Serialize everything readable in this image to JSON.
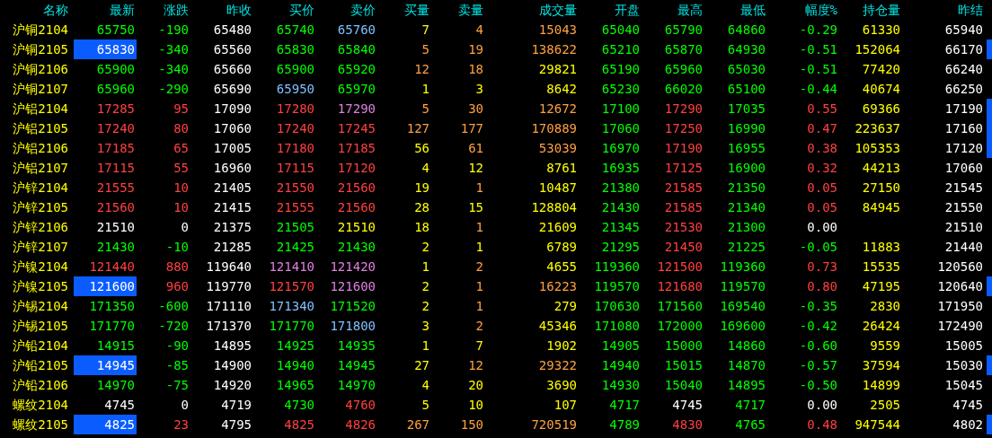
{
  "columns": [
    "名称",
    "最新",
    "涨跌",
    "昨收",
    "买价",
    "卖价",
    "买量",
    "卖量",
    "成交量",
    "开盘",
    "最高",
    "最低",
    "幅度%",
    "持仓量",
    "昨结"
  ],
  "rows": [
    {
      "marked": false,
      "cells": [
        {
          "text": "沪铜2104",
          "color": "#ffff00"
        },
        {
          "text": "65750",
          "color": "#00ff00",
          "flash": false
        },
        {
          "text": "-190",
          "color": "#00ff00"
        },
        {
          "text": "65480",
          "color": "#ffffff"
        },
        {
          "text": "65740",
          "color": "#00ff00"
        },
        {
          "text": "65760",
          "color": "#80c0ff"
        },
        {
          "text": "7",
          "color": "#ffff00"
        },
        {
          "text": "4",
          "color": "#ffa040"
        },
        {
          "text": "15043",
          "color": "#ffa040"
        },
        {
          "text": "65040",
          "color": "#00ff00"
        },
        {
          "text": "65790",
          "color": "#00ff00"
        },
        {
          "text": "64860",
          "color": "#00ff00"
        },
        {
          "text": "-0.29",
          "color": "#00ff00"
        },
        {
          "text": "61330",
          "color": "#ffff00"
        },
        {
          "text": "65940",
          "color": "#ffffff"
        }
      ]
    },
    {
      "marked": true,
      "cells": [
        {
          "text": "沪铜2105",
          "color": "#ffff00"
        },
        {
          "text": "65830",
          "color": "#ffffff",
          "flash": true
        },
        {
          "text": "-340",
          "color": "#00ff00"
        },
        {
          "text": "65560",
          "color": "#ffffff"
        },
        {
          "text": "65830",
          "color": "#00ff00"
        },
        {
          "text": "65840",
          "color": "#00ff00"
        },
        {
          "text": "5",
          "color": "#ffa040"
        },
        {
          "text": "19",
          "color": "#ffa040"
        },
        {
          "text": "138622",
          "color": "#ffa040"
        },
        {
          "text": "65210",
          "color": "#00ff00"
        },
        {
          "text": "65870",
          "color": "#00ff00"
        },
        {
          "text": "64930",
          "color": "#00ff00"
        },
        {
          "text": "-0.51",
          "color": "#00ff00"
        },
        {
          "text": "152064",
          "color": "#ffff00"
        },
        {
          "text": "66170",
          "color": "#ffffff"
        }
      ]
    },
    {
      "marked": false,
      "cells": [
        {
          "text": "沪铜2106",
          "color": "#ffff00"
        },
        {
          "text": "65900",
          "color": "#00ff00",
          "flash": false
        },
        {
          "text": "-340",
          "color": "#00ff00"
        },
        {
          "text": "65660",
          "color": "#ffffff"
        },
        {
          "text": "65900",
          "color": "#00ff00"
        },
        {
          "text": "65920",
          "color": "#00ff00"
        },
        {
          "text": "12",
          "color": "#ffa040"
        },
        {
          "text": "18",
          "color": "#ffa040"
        },
        {
          "text": "29821",
          "color": "#ffff00"
        },
        {
          "text": "65190",
          "color": "#00ff00"
        },
        {
          "text": "65960",
          "color": "#00ff00"
        },
        {
          "text": "65030",
          "color": "#00ff00"
        },
        {
          "text": "-0.51",
          "color": "#00ff00"
        },
        {
          "text": "77420",
          "color": "#ffff00"
        },
        {
          "text": "66240",
          "color": "#ffffff"
        }
      ]
    },
    {
      "marked": false,
      "cells": [
        {
          "text": "沪铜2107",
          "color": "#ffff00"
        },
        {
          "text": "65960",
          "color": "#00ff00",
          "flash": false
        },
        {
          "text": "-290",
          "color": "#00ff00"
        },
        {
          "text": "65690",
          "color": "#ffffff"
        },
        {
          "text": "65950",
          "color": "#80c0ff"
        },
        {
          "text": "65970",
          "color": "#00ff00"
        },
        {
          "text": "1",
          "color": "#ffff00"
        },
        {
          "text": "3",
          "color": "#ffff00"
        },
        {
          "text": "8642",
          "color": "#ffff00"
        },
        {
          "text": "65230",
          "color": "#00ff00"
        },
        {
          "text": "66020",
          "color": "#00ff00"
        },
        {
          "text": "65100",
          "color": "#00ff00"
        },
        {
          "text": "-0.44",
          "color": "#00ff00"
        },
        {
          "text": "40674",
          "color": "#ffff00"
        },
        {
          "text": "66250",
          "color": "#ffffff"
        }
      ]
    },
    {
      "marked": true,
      "cells": [
        {
          "text": "沪铝2104",
          "color": "#ffff00"
        },
        {
          "text": "17285",
          "color": "#ff4040",
          "flash": false
        },
        {
          "text": "95",
          "color": "#ff4040"
        },
        {
          "text": "17090",
          "color": "#ffffff"
        },
        {
          "text": "17280",
          "color": "#ff4040"
        },
        {
          "text": "17290",
          "color": "#e080e0"
        },
        {
          "text": "5",
          "color": "#ffa040"
        },
        {
          "text": "30",
          "color": "#ffa040"
        },
        {
          "text": "12672",
          "color": "#ffa040"
        },
        {
          "text": "17100",
          "color": "#00ff00"
        },
        {
          "text": "17290",
          "color": "#ff4040"
        },
        {
          "text": "17035",
          "color": "#00ff00"
        },
        {
          "text": "0.55",
          "color": "#ff4040"
        },
        {
          "text": "69366",
          "color": "#ffff00"
        },
        {
          "text": "17190",
          "color": "#ffffff"
        }
      ]
    },
    {
      "marked": true,
      "cells": [
        {
          "text": "沪铝2105",
          "color": "#ffff00"
        },
        {
          "text": "17240",
          "color": "#ff4040",
          "flash": false
        },
        {
          "text": "80",
          "color": "#ff4040"
        },
        {
          "text": "17060",
          "color": "#ffffff"
        },
        {
          "text": "17240",
          "color": "#ff4040"
        },
        {
          "text": "17245",
          "color": "#ff4040"
        },
        {
          "text": "127",
          "color": "#ffa040"
        },
        {
          "text": "177",
          "color": "#ffa040"
        },
        {
          "text": "170889",
          "color": "#ffa040"
        },
        {
          "text": "17060",
          "color": "#00ff00"
        },
        {
          "text": "17250",
          "color": "#ff4040"
        },
        {
          "text": "16990",
          "color": "#00ff00"
        },
        {
          "text": "0.47",
          "color": "#ff4040"
        },
        {
          "text": "223637",
          "color": "#ffff00"
        },
        {
          "text": "17160",
          "color": "#ffffff"
        }
      ]
    },
    {
      "marked": true,
      "cells": [
        {
          "text": "沪铝2106",
          "color": "#ffff00"
        },
        {
          "text": "17185",
          "color": "#ff4040",
          "flash": false
        },
        {
          "text": "65",
          "color": "#ff4040"
        },
        {
          "text": "17005",
          "color": "#ffffff"
        },
        {
          "text": "17180",
          "color": "#ff4040"
        },
        {
          "text": "17185",
          "color": "#ff4040"
        },
        {
          "text": "56",
          "color": "#ffff00"
        },
        {
          "text": "61",
          "color": "#ffa040"
        },
        {
          "text": "53039",
          "color": "#ffa040"
        },
        {
          "text": "16970",
          "color": "#00ff00"
        },
        {
          "text": "17190",
          "color": "#ff4040"
        },
        {
          "text": "16955",
          "color": "#00ff00"
        },
        {
          "text": "0.38",
          "color": "#ff4040"
        },
        {
          "text": "105353",
          "color": "#ffff00"
        },
        {
          "text": "17120",
          "color": "#ffffff"
        }
      ]
    },
    {
      "marked": false,
      "cells": [
        {
          "text": "沪铝2107",
          "color": "#ffff00"
        },
        {
          "text": "17115",
          "color": "#ff4040",
          "flash": false
        },
        {
          "text": "55",
          "color": "#ff4040"
        },
        {
          "text": "16960",
          "color": "#ffffff"
        },
        {
          "text": "17115",
          "color": "#ff4040"
        },
        {
          "text": "17120",
          "color": "#ff4040"
        },
        {
          "text": "4",
          "color": "#ffff00"
        },
        {
          "text": "12",
          "color": "#ffff00"
        },
        {
          "text": "8761",
          "color": "#ffff00"
        },
        {
          "text": "16935",
          "color": "#00ff00"
        },
        {
          "text": "17125",
          "color": "#ff4040"
        },
        {
          "text": "16900",
          "color": "#00ff00"
        },
        {
          "text": "0.32",
          "color": "#ff4040"
        },
        {
          "text": "44213",
          "color": "#ffff00"
        },
        {
          "text": "17060",
          "color": "#ffffff"
        }
      ]
    },
    {
      "marked": false,
      "cells": [
        {
          "text": "沪锌2104",
          "color": "#ffff00"
        },
        {
          "text": "21555",
          "color": "#ff4040",
          "flash": false
        },
        {
          "text": "10",
          "color": "#ff4040"
        },
        {
          "text": "21405",
          "color": "#ffffff"
        },
        {
          "text": "21550",
          "color": "#ff4040"
        },
        {
          "text": "21560",
          "color": "#ff4040"
        },
        {
          "text": "19",
          "color": "#ffff00"
        },
        {
          "text": "1",
          "color": "#ffa040"
        },
        {
          "text": "10487",
          "color": "#ffff00"
        },
        {
          "text": "21380",
          "color": "#00ff00"
        },
        {
          "text": "21585",
          "color": "#ff4040"
        },
        {
          "text": "21350",
          "color": "#00ff00"
        },
        {
          "text": "0.05",
          "color": "#ff4040"
        },
        {
          "text": "27150",
          "color": "#ffff00"
        },
        {
          "text": "21545",
          "color": "#ffffff"
        }
      ]
    },
    {
      "marked": false,
      "cells": [
        {
          "text": "沪锌2105",
          "color": "#ffff00"
        },
        {
          "text": "21560",
          "color": "#ff4040",
          "flash": false
        },
        {
          "text": "10",
          "color": "#ff4040"
        },
        {
          "text": "21415",
          "color": "#ffffff"
        },
        {
          "text": "21555",
          "color": "#ff4040"
        },
        {
          "text": "21560",
          "color": "#ff4040"
        },
        {
          "text": "28",
          "color": "#ffff00"
        },
        {
          "text": "15",
          "color": "#ffff00"
        },
        {
          "text": "128804",
          "color": "#ffff00"
        },
        {
          "text": "21430",
          "color": "#00ff00"
        },
        {
          "text": "21585",
          "color": "#ff4040"
        },
        {
          "text": "21340",
          "color": "#00ff00"
        },
        {
          "text": "0.05",
          "color": "#ff4040"
        },
        {
          "text": "84945",
          "color": "#ffff00"
        },
        {
          "text": "21550",
          "color": "#ffffff"
        }
      ]
    },
    {
      "marked": false,
      "cells": [
        {
          "text": "沪锌2106",
          "color": "#ffff00"
        },
        {
          "text": "21510",
          "color": "#ffffff",
          "flash": false
        },
        {
          "text": "0",
          "color": "#ffffff"
        },
        {
          "text": "21375",
          "color": "#ffffff"
        },
        {
          "text": "21505",
          "color": "#00ff00"
        },
        {
          "text": "21510",
          "color": "#ffff00"
        },
        {
          "text": "18",
          "color": "#ffff00"
        },
        {
          "text": "1",
          "color": "#ffa040"
        },
        {
          "text": "21609",
          "color": "#ffff00"
        },
        {
          "text": "21345",
          "color": "#00ff00"
        },
        {
          "text": "21530",
          "color": "#ff4040"
        },
        {
          "text": "21300",
          "color": "#00ff00"
        },
        {
          "text": "0.00",
          "color": "#ffffff"
        },
        null,
        {
          "text": "21510",
          "color": "#ffffff"
        }
      ]
    },
    {
      "marked": false,
      "cells": [
        {
          "text": "沪锌2107",
          "color": "#ffff00"
        },
        {
          "text": "21430",
          "color": "#00ff00",
          "flash": false
        },
        {
          "text": "-10",
          "color": "#00ff00"
        },
        {
          "text": "21285",
          "color": "#ffffff"
        },
        {
          "text": "21425",
          "color": "#00ff00"
        },
        {
          "text": "21430",
          "color": "#00ff00"
        },
        {
          "text": "2",
          "color": "#ffff00"
        },
        {
          "text": "1",
          "color": "#ffff00"
        },
        {
          "text": "6789",
          "color": "#ffff00"
        },
        {
          "text": "21295",
          "color": "#00ff00"
        },
        {
          "text": "21450",
          "color": "#ff4040"
        },
        {
          "text": "21225",
          "color": "#00ff00"
        },
        {
          "text": "-0.05",
          "color": "#00ff00"
        },
        {
          "text": "11883",
          "color": "#ffff00"
        },
        {
          "text": "21440",
          "color": "#ffffff"
        }
      ]
    },
    {
      "marked": false,
      "cells": [
        {
          "text": "沪镍2104",
          "color": "#ffff00"
        },
        {
          "text": "121440",
          "color": "#ff4040",
          "flash": false
        },
        {
          "text": "880",
          "color": "#ff4040"
        },
        {
          "text": "119640",
          "color": "#ffffff"
        },
        {
          "text": "121410",
          "color": "#e080e0"
        },
        {
          "text": "121420",
          "color": "#e080e0"
        },
        {
          "text": "1",
          "color": "#ffff00"
        },
        {
          "text": "2",
          "color": "#ffa040"
        },
        {
          "text": "4655",
          "color": "#ffff00"
        },
        {
          "text": "119360",
          "color": "#00ff00"
        },
        {
          "text": "121500",
          "color": "#ff4040"
        },
        {
          "text": "119360",
          "color": "#00ff00"
        },
        {
          "text": "0.73",
          "color": "#ff4040"
        },
        {
          "text": "15535",
          "color": "#ffff00"
        },
        {
          "text": "120560",
          "color": "#ffffff"
        }
      ]
    },
    {
      "marked": true,
      "cells": [
        {
          "text": "沪镍2105",
          "color": "#ffff00"
        },
        {
          "text": "121600",
          "color": "#ffffff",
          "flash": true
        },
        {
          "text": "960",
          "color": "#ff4040"
        },
        {
          "text": "119770",
          "color": "#ffffff"
        },
        {
          "text": "121570",
          "color": "#ff4040"
        },
        {
          "text": "121600",
          "color": "#e080e0"
        },
        {
          "text": "2",
          "color": "#ffff00"
        },
        {
          "text": "1",
          "color": "#ffa040"
        },
        {
          "text": "16223",
          "color": "#ffa040"
        },
        {
          "text": "119570",
          "color": "#00ff00"
        },
        {
          "text": "121680",
          "color": "#ff4040"
        },
        {
          "text": "119570",
          "color": "#00ff00"
        },
        {
          "text": "0.80",
          "color": "#ff4040"
        },
        {
          "text": "47195",
          "color": "#ffff00"
        },
        {
          "text": "120640",
          "color": "#ffffff"
        }
      ]
    },
    {
      "marked": false,
      "cells": [
        {
          "text": "沪锡2104",
          "color": "#ffff00"
        },
        {
          "text": "171350",
          "color": "#00ff00",
          "flash": false
        },
        {
          "text": "-600",
          "color": "#00ff00"
        },
        {
          "text": "171110",
          "color": "#ffffff"
        },
        {
          "text": "171340",
          "color": "#80c0ff"
        },
        {
          "text": "171520",
          "color": "#00ff00"
        },
        {
          "text": "2",
          "color": "#ffff00"
        },
        {
          "text": "1",
          "color": "#ffa040"
        },
        {
          "text": "279",
          "color": "#ffff00"
        },
        {
          "text": "170630",
          "color": "#00ff00"
        },
        {
          "text": "171560",
          "color": "#00ff00"
        },
        {
          "text": "169540",
          "color": "#00ff00"
        },
        {
          "text": "-0.35",
          "color": "#00ff00"
        },
        {
          "text": "2830",
          "color": "#ffff00"
        },
        {
          "text": "171950",
          "color": "#ffffff"
        }
      ]
    },
    {
      "marked": false,
      "cells": [
        {
          "text": "沪锡2105",
          "color": "#ffff00"
        },
        {
          "text": "171770",
          "color": "#00ff00",
          "flash": false
        },
        {
          "text": "-720",
          "color": "#00ff00"
        },
        {
          "text": "171370",
          "color": "#ffffff"
        },
        {
          "text": "171770",
          "color": "#00ff00"
        },
        {
          "text": "171800",
          "color": "#80c0ff"
        },
        {
          "text": "3",
          "color": "#ffff00"
        },
        {
          "text": "2",
          "color": "#ffa040"
        },
        {
          "text": "45346",
          "color": "#ffff00"
        },
        {
          "text": "171080",
          "color": "#00ff00"
        },
        {
          "text": "172000",
          "color": "#00ff00"
        },
        {
          "text": "169600",
          "color": "#00ff00"
        },
        {
          "text": "-0.42",
          "color": "#00ff00"
        },
        {
          "text": "26424",
          "color": "#ffff00"
        },
        {
          "text": "172490",
          "color": "#ffffff"
        }
      ]
    },
    {
      "marked": false,
      "cells": [
        {
          "text": "沪铅2104",
          "color": "#ffff00"
        },
        {
          "text": "14915",
          "color": "#00ff00",
          "flash": false
        },
        {
          "text": "-90",
          "color": "#00ff00"
        },
        {
          "text": "14895",
          "color": "#ffffff"
        },
        {
          "text": "14925",
          "color": "#00ff00"
        },
        {
          "text": "14935",
          "color": "#00ff00"
        },
        {
          "text": "1",
          "color": "#ffff00"
        },
        {
          "text": "7",
          "color": "#ffff00"
        },
        {
          "text": "1902",
          "color": "#ffff00"
        },
        {
          "text": "14905",
          "color": "#00ff00"
        },
        {
          "text": "15000",
          "color": "#00ff00"
        },
        {
          "text": "14860",
          "color": "#00ff00"
        },
        {
          "text": "-0.60",
          "color": "#00ff00"
        },
        {
          "text": "9559",
          "color": "#ffff00"
        },
        {
          "text": "15005",
          "color": "#ffffff"
        }
      ]
    },
    {
      "marked": true,
      "cells": [
        {
          "text": "沪铅2105",
          "color": "#ffff00"
        },
        {
          "text": "14945",
          "color": "#ffffff",
          "flash": true
        },
        {
          "text": "-85",
          "color": "#00ff00"
        },
        {
          "text": "14900",
          "color": "#ffffff"
        },
        {
          "text": "14940",
          "color": "#00ff00"
        },
        {
          "text": "14945",
          "color": "#00ff00"
        },
        {
          "text": "27",
          "color": "#ffff00"
        },
        {
          "text": "12",
          "color": "#ffa040"
        },
        {
          "text": "29322",
          "color": "#ffa040"
        },
        {
          "text": "14940",
          "color": "#00ff00"
        },
        {
          "text": "15015",
          "color": "#00ff00"
        },
        {
          "text": "14870",
          "color": "#00ff00"
        },
        {
          "text": "-0.57",
          "color": "#00ff00"
        },
        {
          "text": "37594",
          "color": "#ffff00"
        },
        {
          "text": "15030",
          "color": "#ffffff"
        }
      ]
    },
    {
      "marked": false,
      "cells": [
        {
          "text": "沪铅2106",
          "color": "#ffff00"
        },
        {
          "text": "14970",
          "color": "#00ff00",
          "flash": false
        },
        {
          "text": "-75",
          "color": "#00ff00"
        },
        {
          "text": "14920",
          "color": "#ffffff"
        },
        {
          "text": "14965",
          "color": "#00ff00"
        },
        {
          "text": "14970",
          "color": "#00ff00"
        },
        {
          "text": "4",
          "color": "#ffff00"
        },
        {
          "text": "20",
          "color": "#ffff00"
        },
        {
          "text": "3690",
          "color": "#ffff00"
        },
        {
          "text": "14930",
          "color": "#00ff00"
        },
        {
          "text": "15040",
          "color": "#00ff00"
        },
        {
          "text": "14895",
          "color": "#00ff00"
        },
        {
          "text": "-0.50",
          "color": "#00ff00"
        },
        {
          "text": "14899",
          "color": "#ffff00"
        },
        {
          "text": "15045",
          "color": "#ffffff"
        }
      ]
    },
    {
      "marked": false,
      "cells": [
        {
          "text": "螺纹2104",
          "color": "#ffff00"
        },
        {
          "text": "4745",
          "color": "#ffffff",
          "flash": false
        },
        {
          "text": "0",
          "color": "#ffffff"
        },
        {
          "text": "4719",
          "color": "#ffffff"
        },
        {
          "text": "4730",
          "color": "#00ff00"
        },
        {
          "text": "4760",
          "color": "#ff4040"
        },
        {
          "text": "5",
          "color": "#ffff00"
        },
        {
          "text": "10",
          "color": "#ffff00"
        },
        {
          "text": "107",
          "color": "#ffff00"
        },
        {
          "text": "4717",
          "color": "#00ff00"
        },
        {
          "text": "4745",
          "color": "#ffffff"
        },
        {
          "text": "4717",
          "color": "#00ff00"
        },
        {
          "text": "0.00",
          "color": "#ffffff"
        },
        {
          "text": "2505",
          "color": "#ffff00"
        },
        {
          "text": "4745",
          "color": "#ffffff"
        }
      ]
    },
    {
      "marked": true,
      "cells": [
        {
          "text": "螺纹2105",
          "color": "#ffff00"
        },
        {
          "text": "4825",
          "color": "#ffffff",
          "flash": true
        },
        {
          "text": "23",
          "color": "#ff4040"
        },
        {
          "text": "4795",
          "color": "#ffffff"
        },
        {
          "text": "4825",
          "color": "#ff4040"
        },
        {
          "text": "4826",
          "color": "#ff4040"
        },
        {
          "text": "267",
          "color": "#ffa040"
        },
        {
          "text": "150",
          "color": "#ffa040"
        },
        {
          "text": "720519",
          "color": "#ffa040"
        },
        {
          "text": "4789",
          "color": "#00ff00"
        },
        {
          "text": "4830",
          "color": "#ff4040"
        },
        {
          "text": "4765",
          "color": "#00ff00"
        },
        {
          "text": "0.48",
          "color": "#ff4040"
        },
        {
          "text": "947544",
          "color": "#ffff00"
        },
        {
          "text": "4802",
          "color": "#ffffff"
        }
      ]
    }
  ]
}
